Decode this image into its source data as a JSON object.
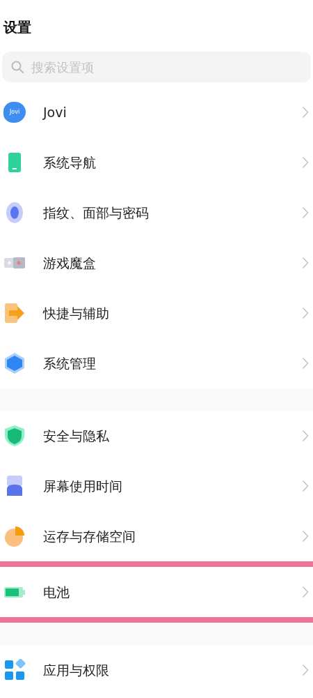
{
  "title": "设置",
  "search": {
    "placeholder": "搜索设置项"
  },
  "groups": [
    {
      "items": [
        {
          "kind": "jovi",
          "icon_text": "Jovi",
          "label": "Jovi",
          "highlighted": false
        },
        {
          "kind": "phone",
          "label": "系统导航",
          "highlighted": false
        },
        {
          "kind": "fingerprint",
          "label": "指纹、面部与密码",
          "highlighted": false
        },
        {
          "kind": "game",
          "label": "游戏魔盒",
          "highlighted": false
        },
        {
          "kind": "arrow",
          "label": "快捷与辅助",
          "highlighted": false
        },
        {
          "kind": "hexagon",
          "label": "系统管理",
          "highlighted": false
        }
      ]
    },
    {
      "items": [
        {
          "kind": "shield",
          "label": "安全与隐私",
          "highlighted": false
        },
        {
          "kind": "hourglass",
          "label": "屏幕使用时间",
          "highlighted": false
        },
        {
          "kind": "pie",
          "label": "运存与存储空间",
          "highlighted": false
        },
        {
          "kind": "battery",
          "label": "电池",
          "highlighted": true
        }
      ]
    },
    {
      "items": [
        {
          "kind": "grid",
          "label": "应用与权限",
          "highlighted": false
        }
      ]
    }
  ]
}
